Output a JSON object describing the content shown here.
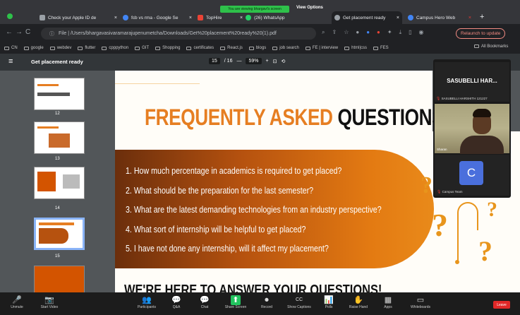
{
  "browser": {
    "tabs": [
      {
        "label": "Check your Apple ID de",
        "color": "#9aa0a6"
      },
      {
        "label": "fcb vs rma - Google Se",
        "color": "#4285f4"
      },
      {
        "label": "TopHire",
        "color": "#ea4335"
      },
      {
        "label": "(26) WhatsApp",
        "color": "#25d366"
      },
      {
        "label": "Get placement ready",
        "color": "#9aa0a6"
      },
      {
        "label": "Campus Hero Web",
        "color": "#4285f4"
      }
    ],
    "share_banner": "You are viewing bhargavi's screen",
    "view_options": "View Options",
    "url": "File | /Users/bhargavasivaramarajupenumetcha/Downloads/Get%20placement%20ready%20(1).pdf",
    "relaunch": "Relaunch to update",
    "bookmarks": [
      "CN",
      "google",
      "webdev",
      "flutter",
      "cpppython",
      "GIT",
      "Shopping",
      "certificates",
      "React.js",
      "blogs",
      "job search",
      "FE | interview",
      "html|css",
      "FES"
    ],
    "all_bookmarks": "All Bookmarks"
  },
  "pdf": {
    "title": "Get placement ready",
    "page_current": "15",
    "page_total": "/ 16",
    "zoom": "59%",
    "thumbnails": [
      {
        "page": "12"
      },
      {
        "page": "13"
      },
      {
        "page": "14"
      },
      {
        "page": "15"
      }
    ]
  },
  "slide": {
    "title_part1": "FREQUENTLY ASKED",
    "title_part2": "QUESTIONS",
    "questions": [
      "1. How much percentage in academics is required to get placed?",
      "2. What should be the preparation for the last semester?",
      "3. What are the latest demanding technologies from an industry perspective?",
      "4. What sort of internship will be helpful to get placed?",
      "5. I have not done any internship, will it affect my placement?"
    ],
    "bottom_title": "WE'RE HERE TO ANSWER YOUR QUESTIONS!"
  },
  "meeting": {
    "host_name": "SASUBELLI HAR...",
    "host_subtitle": "SASUBELLI HARSHITH 121227",
    "video_name": "Sharan",
    "avatar_letter": "C",
    "campus_name": "Campus Team",
    "toolbar": [
      {
        "label": "Unmute",
        "icon": "🎤"
      },
      {
        "label": "Start Video",
        "icon": "📷"
      },
      {
        "label": "Participants",
        "icon": "👥"
      },
      {
        "label": "Q&A",
        "icon": "💬"
      },
      {
        "label": "Chat",
        "icon": "💬"
      },
      {
        "label": "Share Screen",
        "icon": "⬆"
      },
      {
        "label": "Record",
        "icon": "⏺"
      },
      {
        "label": "Show Captions",
        "icon": "CC"
      },
      {
        "label": "Polls",
        "icon": "📊"
      },
      {
        "label": "Raise Hand",
        "icon": "✋"
      },
      {
        "label": "Apps",
        "icon": "▦"
      },
      {
        "label": "Whiteboards",
        "icon": "▭"
      }
    ],
    "leave": "Leave"
  }
}
